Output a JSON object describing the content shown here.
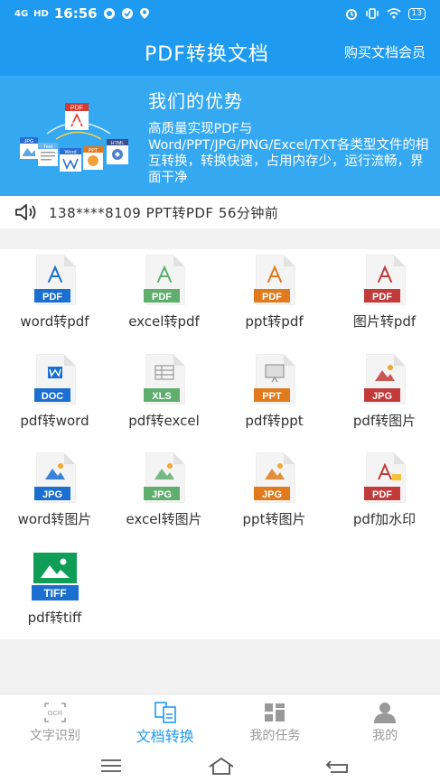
{
  "status": {
    "network": "4G",
    "hd": "HD",
    "time": "16:56",
    "battery": "13"
  },
  "header": {
    "title": "PDF转换文档",
    "vip": "购买文档会员"
  },
  "banner": {
    "title": "我们的优势",
    "desc": "高质量实现PDF与Word/PPT/JPG/PNG/Excel/TXT各类型文件的相互转换，转换快速，占用内存少，运行流畅，界面干净"
  },
  "notice": {
    "text": "138****8109  PPT转PDF  56分钟前"
  },
  "tools": [
    {
      "label": "word转pdf",
      "badge": "PDF",
      "icon": "pdf-acrobat-icon"
    },
    {
      "label": "excel转pdf",
      "badge": "PDF",
      "icon": "pdf-acrobat-icon"
    },
    {
      "label": "ppt转pdf",
      "badge": "PDF",
      "icon": "pdf-acrobat-icon"
    },
    {
      "label": "图片转pdf",
      "badge": "PDF",
      "icon": "pdf-acrobat-icon"
    },
    {
      "label": "pdf转word",
      "badge": "DOC",
      "icon": "word-icon"
    },
    {
      "label": "pdf转excel",
      "badge": "XLS",
      "icon": "excel-icon"
    },
    {
      "label": "pdf转ppt",
      "badge": "PPT",
      "icon": "ppt-icon"
    },
    {
      "label": "pdf转图片",
      "badge": "JPG",
      "icon": "image-icon"
    },
    {
      "label": "word转图片",
      "badge": "JPG",
      "icon": "image-icon"
    },
    {
      "label": "excel转图片",
      "badge": "JPG",
      "icon": "image-icon"
    },
    {
      "label": "ppt转图片",
      "badge": "JPG",
      "icon": "image-icon"
    },
    {
      "label": "pdf加水印",
      "badge": "PDF",
      "icon": "watermark-icon"
    },
    {
      "label": "pdf转tiff",
      "badge": "TIFF",
      "icon": "tiff-icon"
    }
  ],
  "nav": [
    {
      "label": "文字识别",
      "icon": "ocr-icon",
      "active": false
    },
    {
      "label": "文档转换",
      "icon": "doc-convert-icon",
      "active": true
    },
    {
      "label": "我的任务",
      "icon": "tasks-icon",
      "active": false
    },
    {
      "label": "我的",
      "icon": "profile-icon",
      "active": false
    }
  ],
  "banner_art": {
    "pdf": "PDF",
    "jpg": "JPG",
    "text": "Text",
    "word": "Word",
    "ppt": "PPT",
    "html": "HTML"
  },
  "nav_art": {
    "ocr": "OCR"
  },
  "colors": {
    "primary": "#1e9bf0",
    "banner": "#35a8f2",
    "blue_badge": "#1a6fd0",
    "green_badge": "#5fae6e",
    "orange_badge": "#e07a1c",
    "red_badge": "#c23a3a",
    "tiff": "#0f9d58"
  }
}
